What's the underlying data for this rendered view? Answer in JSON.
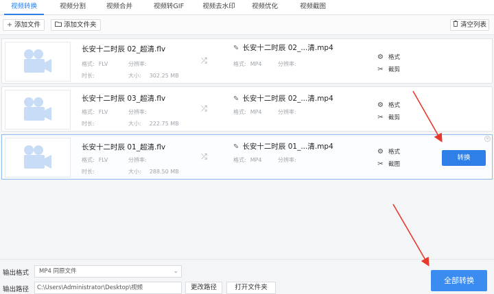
{
  "tabs": [
    {
      "label": "视频转换",
      "active": true
    },
    {
      "label": "视频分割"
    },
    {
      "label": "视频合并"
    },
    {
      "label": "视频转GIF"
    },
    {
      "label": "视频去水印"
    },
    {
      "label": "视频优化"
    },
    {
      "label": "视频截图"
    }
  ],
  "toolbar": {
    "add_file": "添加文件",
    "add_folder": "添加文件夹",
    "clear_list": "清空列表"
  },
  "labels": {
    "format": "格式:",
    "resolution": "分辨率:",
    "duration": "时长:",
    "size": "大小:",
    "action_format": "格式",
    "action_cut": "截剪",
    "action_cut_alt": "截图",
    "convert": "转换"
  },
  "files": [
    {
      "src_name": "长安十二时辰 02_超清.flv",
      "src_format": "FLV",
      "size": "302.25 MB",
      "out_name": "长安十二时辰 02_...清.mp4",
      "out_format": "MP4"
    },
    {
      "src_name": "长安十二时辰 03_超清.flv",
      "src_format": "FLV",
      "size": "222.75 MB",
      "out_name": "长安十二时辰 02_...清.mp4",
      "out_format": "MP4"
    },
    {
      "src_name": "长安十二时辰 01_超清.flv",
      "src_format": "FLV",
      "size": "288.50 MB",
      "out_name": "长安十二时辰 01_...清.mp4",
      "out_format": "MP4"
    }
  ],
  "bottom": {
    "output_format_label": "输出格式",
    "output_format_value": "MP4  同原文件",
    "output_path_label": "输出路径",
    "output_path_value": "C:\\Users\\Administrator\\Desktop\\视频",
    "change_path": "更改路径",
    "open_folder": "打开文件夹",
    "convert_all": "全部转换"
  },
  "colors": {
    "accent": "#2f7fe8",
    "arrow": "#e8382a"
  }
}
